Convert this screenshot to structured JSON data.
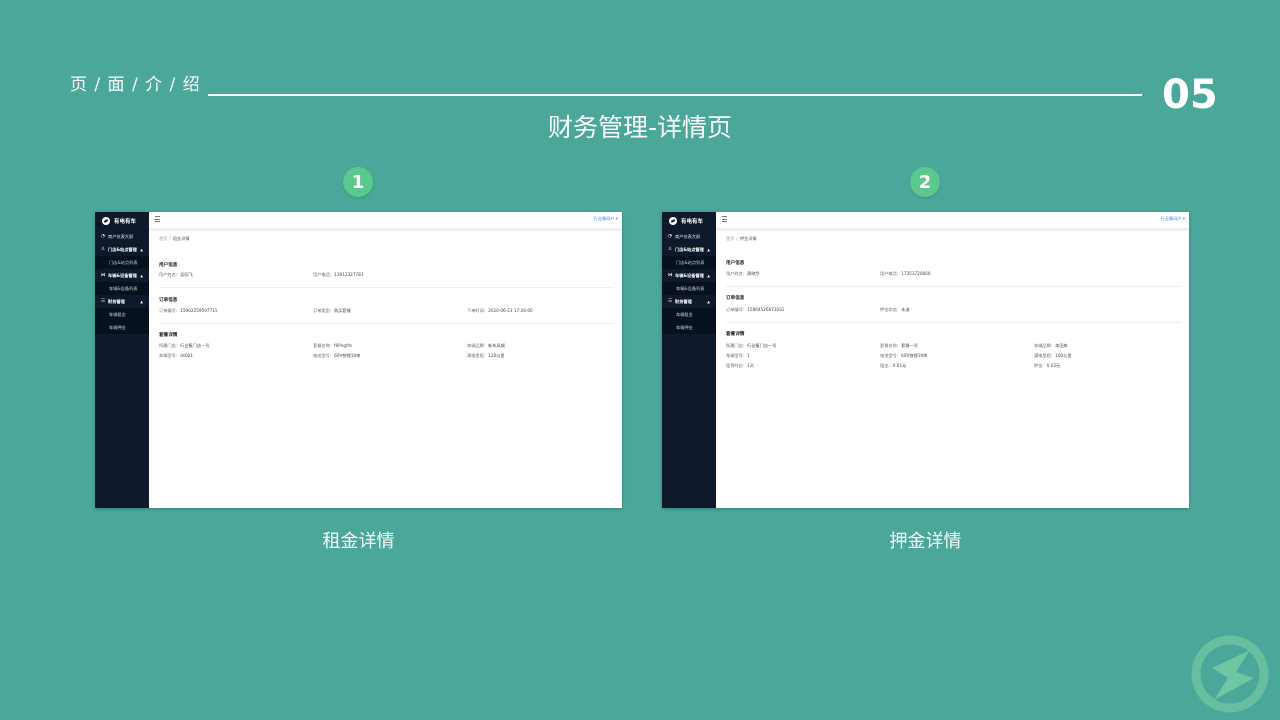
{
  "header": {
    "section_label": "页 / 面 / 介 / 绍",
    "page_number": "05",
    "title": "财务管理-详情页"
  },
  "screens": [
    {
      "step": "1",
      "caption": "租金详情",
      "app_name": "有电有车",
      "top_user": "行业集网户 ▾",
      "nav": [
        {
          "label": "商户仪表大屏",
          "icon": "dashboard-icon",
          "type": "item"
        },
        {
          "label": "门店&站点管理",
          "icon": "store-icon",
          "type": "group"
        },
        {
          "label": "门店&站点列表",
          "type": "sub"
        },
        {
          "label": "车辆&设备管理",
          "icon": "vehicle-icon",
          "type": "group"
        },
        {
          "label": "车辆&设备列表",
          "type": "sub"
        },
        {
          "label": "财务管理",
          "icon": "finance-icon",
          "type": "group"
        },
        {
          "label": "车辆租金",
          "type": "sub"
        },
        {
          "label": "车辆押金",
          "type": "sub"
        }
      ],
      "breadcrumb": {
        "home": "首页",
        "current": "租金详情"
      },
      "user_section": {
        "title": "用户信息",
        "name_label": "用户姓名:",
        "name": "吴阳飞",
        "phone_label": "用户电话:",
        "phone": "13912327781"
      },
      "order_section": {
        "title": "订单信息",
        "f1_label": "订单编号:",
        "f1": "15902259597711",
        "f2_label": "订单类型:",
        "f2": "购买套餐",
        "f3_label": "下单时间:",
        "f3": "2020-06-23 17:26:00"
      },
      "package_section": {
        "title": "套餐详情",
        "r1": [
          {
            "label": "所属门店:",
            "value": "行业集门店一号"
          },
          {
            "label": "套餐名称:",
            "value": "f0Pngfrb"
          },
          {
            "label": "车辆品牌:",
            "value": "新东风顺"
          }
        ],
        "r2": [
          {
            "label": "车辆型号:",
            "value": "ds001"
          },
          {
            "label": "电池型号:",
            "value": "60V铁锂19串"
          },
          {
            "label": "满电里程:",
            "value": "120公里"
          }
        ]
      }
    },
    {
      "step": "2",
      "caption": "押金详情",
      "app_name": "有电有车",
      "top_user": "行业集网户 ▾",
      "nav": [
        {
          "label": "商户仪表大屏",
          "icon": "dashboard-icon",
          "type": "item"
        },
        {
          "label": "门店&站点管理",
          "icon": "store-icon",
          "type": "group"
        },
        {
          "label": "门店&站点列表",
          "type": "sub"
        },
        {
          "label": "车辆&设备管理",
          "icon": "vehicle-icon",
          "type": "group"
        },
        {
          "label": "车辆&设备列表",
          "type": "sub"
        },
        {
          "label": "财务管理",
          "icon": "finance-icon",
          "type": "group"
        },
        {
          "label": "车辆租金",
          "type": "sub"
        },
        {
          "label": "车辆押金",
          "type": "sub"
        }
      ],
      "breadcrumb": {
        "home": "首页",
        "current": "押金详情"
      },
      "user_section": {
        "title": "用户信息",
        "name_label": "用户姓名:",
        "name": "周晓华",
        "phone_label": "用户电话:",
        "phone": "17353720660"
      },
      "order_section": {
        "title": "订单信息",
        "f1_label": "订单编号:",
        "f1": "15894526672031",
        "f2_label": "押金状态:",
        "f2": "未退",
        "f3_label": "",
        "f3": ""
      },
      "package_section": {
        "title": "套餐详情",
        "r1": [
          {
            "label": "所属门店:",
            "value": "行业集门店一号"
          },
          {
            "label": "套餐名称:",
            "value": "套餐一号"
          },
          {
            "label": "车辆品牌:",
            "value": "本田车"
          }
        ],
        "r2": [
          {
            "label": "车辆型号:",
            "value": "1"
          },
          {
            "label": "电池型号:",
            "value": "60V铁锂19串"
          },
          {
            "label": "满电里程:",
            "value": "100公里"
          }
        ],
        "r3": [
          {
            "label": "租赁时长:",
            "value": "1天"
          },
          {
            "label": "租金:",
            "value": "0.01元"
          },
          {
            "label": "押金:",
            "value": "0.02元"
          }
        ]
      }
    }
  ]
}
